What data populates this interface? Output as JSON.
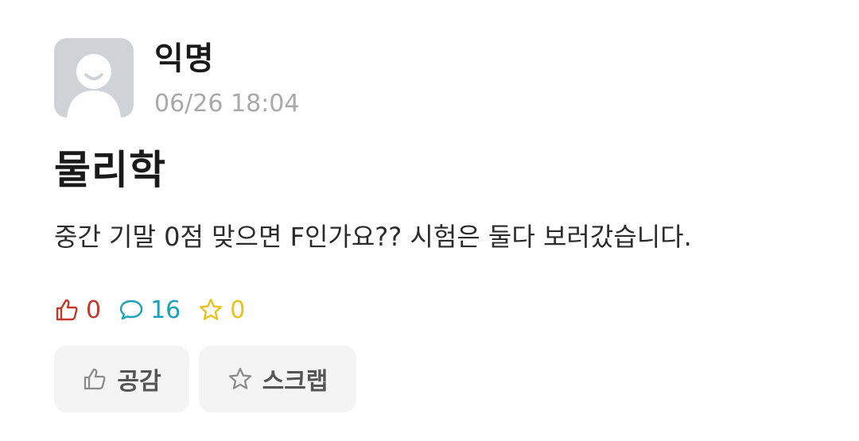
{
  "post": {
    "author": "익명",
    "timestamp": "06/26 18:04",
    "title": "물리학",
    "body": "중간 기말 0점 맞으면 F인가요?? 시험은 둘다 보러갔습니다."
  },
  "stats": {
    "likes": "0",
    "comments": "16",
    "scraps": "0"
  },
  "actions": {
    "like_label": "공감",
    "scrap_label": "스크랩"
  },
  "icons": {
    "avatar": "default-avatar-icon",
    "like": "thumbs-up-icon",
    "comment": "speech-bubble-icon",
    "scrap": "star-icon"
  },
  "colors": {
    "like": "#c0392b",
    "comment": "#1aa3b8",
    "scrap": "#e9c21b",
    "timestamp": "#a9a9a9",
    "button_bg": "#f4f4f4"
  }
}
